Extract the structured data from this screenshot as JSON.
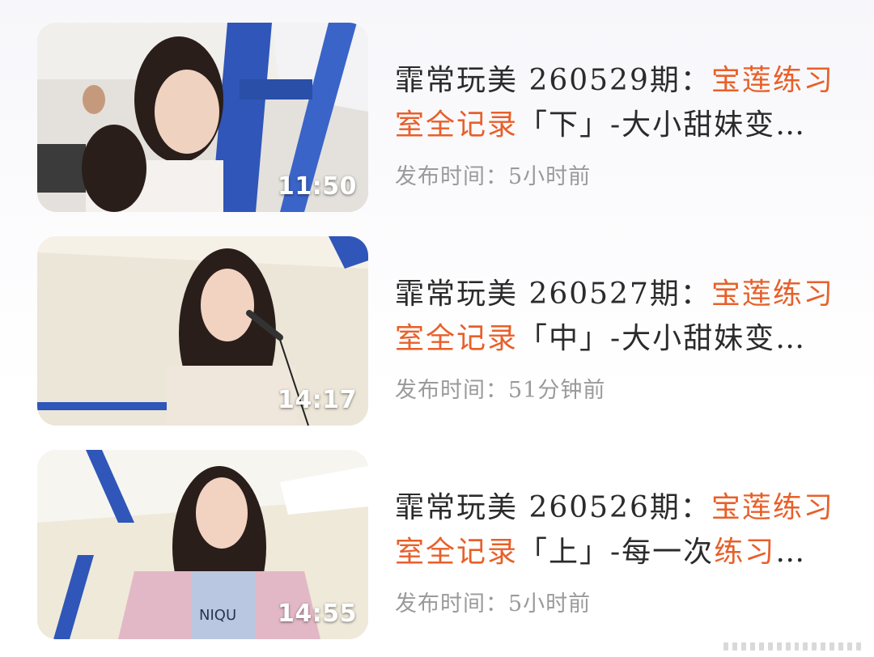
{
  "videos": [
    {
      "title_line1_prefix": "霏常玩美 260529期：",
      "title_line1_highlight": "宝莲练习",
      "title_line2_highlight": "室全记录",
      "title_line2_rest": "「下」-大小甜妹变…",
      "meta": "发布时间：5小时前",
      "duration": "11:50"
    },
    {
      "title_line1_prefix": "霏常玩美 260527期：",
      "title_line1_highlight": "宝莲练习",
      "title_line2_highlight": "室全记录",
      "title_line2_rest": "「中」-大小甜妹变…",
      "meta": "发布时间：51分钟前",
      "duration": "14:17"
    },
    {
      "title_line1_prefix": "霏常玩美 260526期：",
      "title_line1_highlight": "宝莲练习",
      "title_line2_highlight": "室全记录",
      "title_line2_rest": "「上」-每一次",
      "title_line2_highlight2": "练习",
      "title_line2_ellipsis": "…",
      "meta": "发布时间：5小时前",
      "duration": "14:55"
    }
  ],
  "colors": {
    "highlight": "#e8602a",
    "title": "#2b2b2b",
    "meta": "#9a9a9a"
  }
}
